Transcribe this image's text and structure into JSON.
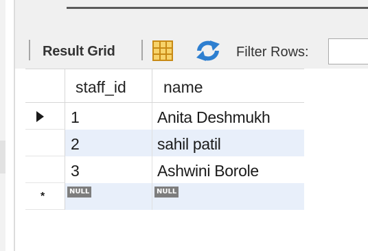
{
  "toolbar": {
    "result_grid_label": "Result Grid",
    "grid_icon": "grid-view-icon",
    "refresh_icon": "refresh-icon",
    "filter_label": "Filter Rows:",
    "filter_value": ""
  },
  "grid": {
    "columns": [
      "staff_id",
      "name"
    ],
    "rows": [
      {
        "staff_id": "1",
        "name": "Anita Deshmukh",
        "indicator": "current-row-arrow"
      },
      {
        "staff_id": "2",
        "name": "sahil patil",
        "indicator": ""
      },
      {
        "staff_id": "3",
        "name": "Ashwini Borole",
        "indicator": ""
      }
    ],
    "new_row": {
      "indicator": "*",
      "staff_id": "NULL",
      "name": "NULL"
    }
  },
  "colors": {
    "toolbar_bg": "#f0f0f0",
    "alt_row_bg": "#e8effa",
    "null_badge": "#7d7d7d",
    "grid_icon": "#f7d36a",
    "refresh_icon": "#2e7fd0"
  }
}
